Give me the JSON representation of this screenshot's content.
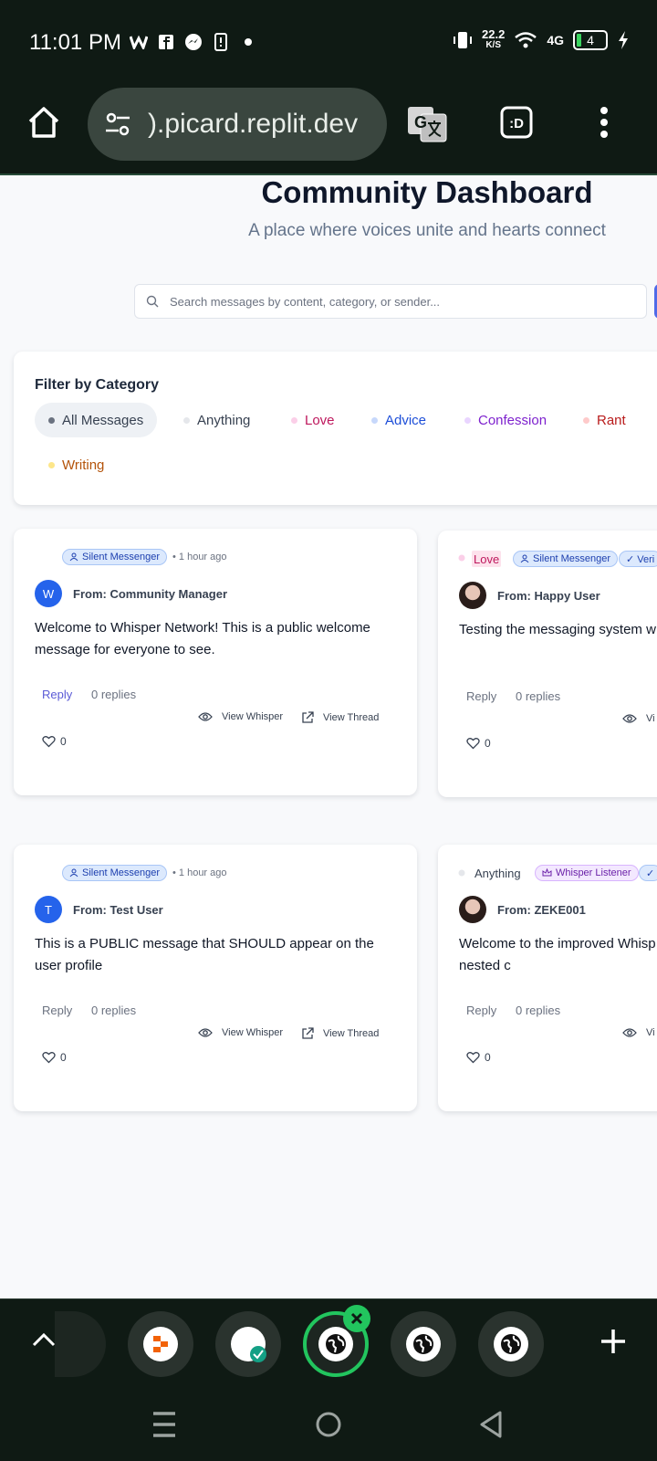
{
  "status_bar": {
    "time": "11:01 PM",
    "speed_value": "22.2",
    "speed_unit": "K/S",
    "network": "4G",
    "battery": "4"
  },
  "browser": {
    "url": ").picard.replit.dev"
  },
  "page": {
    "title": "Community Dashboard",
    "subtitle": "A place where voices unite and hearts connect",
    "search_placeholder": "Search messages by content, category, or sender..."
  },
  "filter": {
    "title": "Filter by Category",
    "categories": [
      {
        "label": "All Messages",
        "color": "#374151",
        "dot": "#6b7280"
      },
      {
        "label": "Anything",
        "color": "#374151",
        "dot": "#e5e7eb"
      },
      {
        "label": "Love",
        "color": "#be185d",
        "dot": "#fbcfe8"
      },
      {
        "label": "Advice",
        "color": "#1d4ed8",
        "dot": "#c7d8fb"
      },
      {
        "label": "Confession",
        "color": "#7e22ce",
        "dot": "#e9d5ff"
      },
      {
        "label": "Rant",
        "color": "#b91c1c",
        "dot": "#fecaca"
      },
      {
        "label": "Writing",
        "color": "#b45309",
        "dot": "#fde68a"
      }
    ]
  },
  "cards": [
    {
      "badge": "Silent Messenger",
      "time": "• 1 hour ago",
      "avatar": "W",
      "from": "From: Community Manager",
      "message": "Welcome to Whisper Network! This is a public welcome message for everyone to see.",
      "reply": "Reply",
      "replies": "0 replies",
      "view_whisper": "View Whisper",
      "view_thread": "View Thread",
      "likes": "0"
    },
    {
      "category": "Love",
      "badge": "Silent Messenger",
      "badge2": "✓ Veri",
      "from": "From: Happy User",
      "message": "Testing the messaging system w Love category.",
      "reply": "Reply",
      "replies": "0 replies",
      "view_whisper": "Vi",
      "likes": "0"
    },
    {
      "badge": "Silent Messenger",
      "time": "• 1 hour ago",
      "avatar": "T",
      "from": "From: Test User",
      "message": "This is a PUBLIC message that SHOULD appear on the user profile",
      "reply": "Reply",
      "replies": "0 replies",
      "view_whisper": "View Whisper",
      "view_thread": "View Thread",
      "likes": "0"
    },
    {
      "category": "Anything",
      "badge": "Whisper Listener",
      "badge2": "✓",
      "from": "From: ZEKE001",
      "message": "Welcome to the improved Whisp system supports proper nested c",
      "reply": "Reply",
      "replies": "0 replies",
      "view_whisper": "Vi",
      "likes": "0"
    }
  ],
  "tabs": {
    "count": 5,
    "active_index": 2
  }
}
